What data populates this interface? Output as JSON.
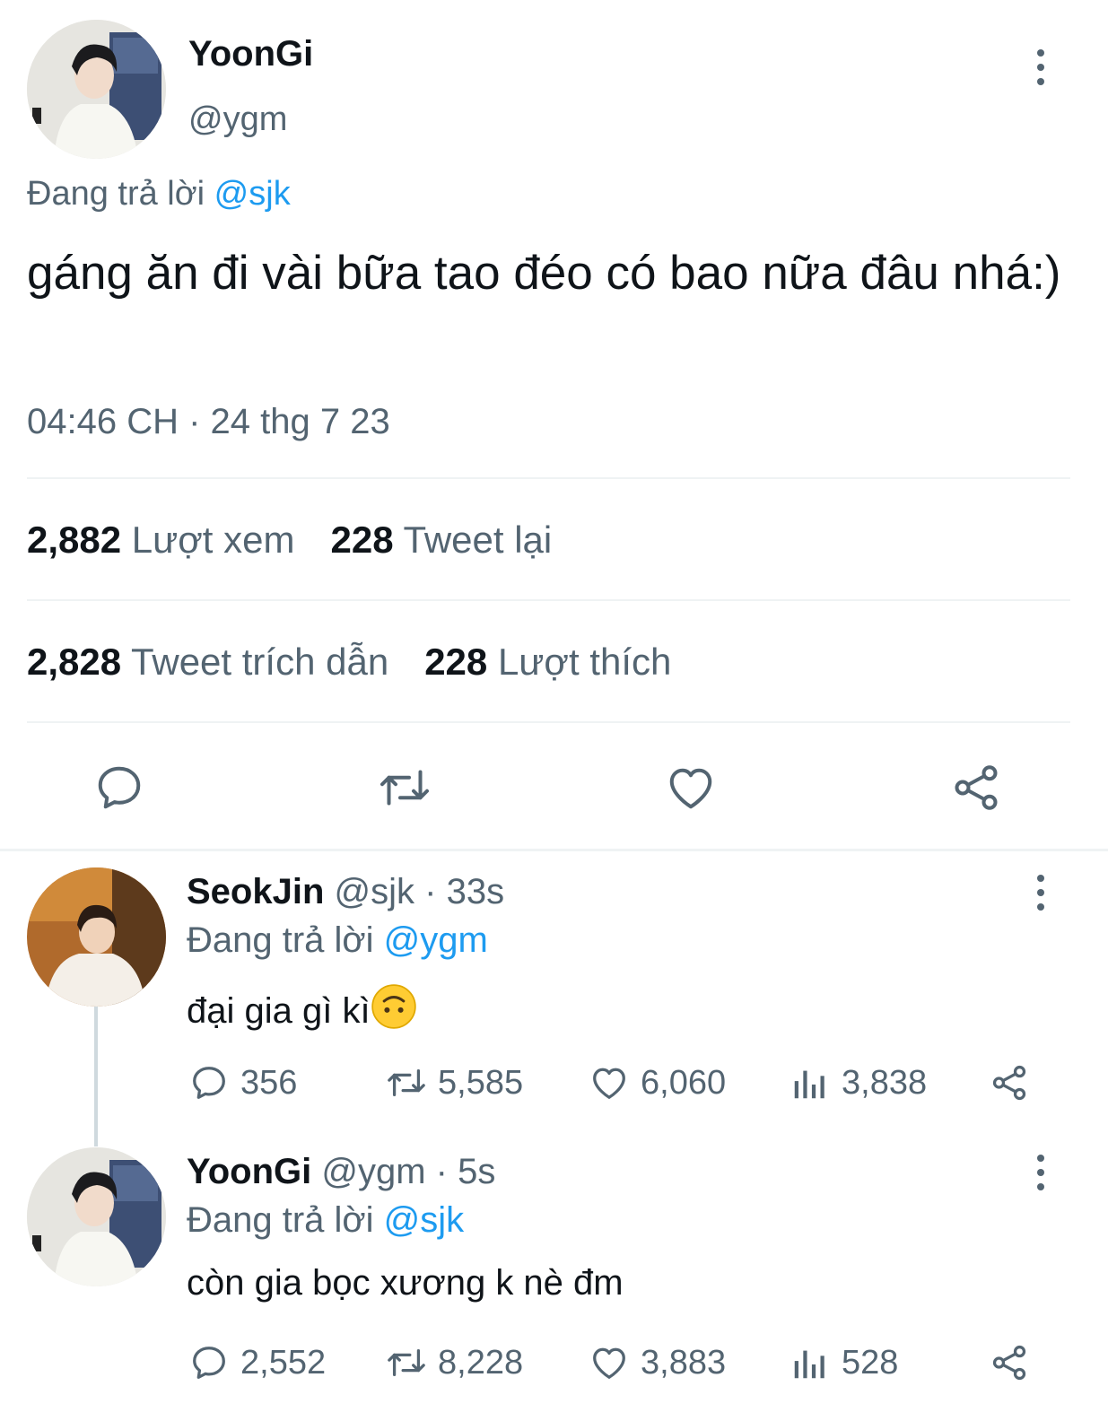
{
  "main_tweet": {
    "display_name": "YoonGi",
    "handle": "@ygm",
    "reply_prefix": "Đang trả lời",
    "reply_to": "@sjk",
    "text": "gáng ăn đi vài bữa tao đéo có bao nữa đâu nhá:)",
    "timestamp": "04:46 CH · 24 thg 7 23",
    "stats": {
      "views_num": "2,882",
      "views_label": "Lượt xem",
      "retweets_num": "228",
      "retweets_label": "Tweet lại",
      "quotes_num": "2,828",
      "quotes_label": "Tweet trích dẫn",
      "likes_num": "228",
      "likes_label": "Lượt thích"
    },
    "icons": [
      "reply-icon",
      "retweet-icon",
      "like-icon",
      "share-icon",
      "more-icon"
    ]
  },
  "replies": [
    {
      "display_name": "SeokJin",
      "handle": "@sjk",
      "time": "· 33s",
      "reply_prefix": "Đang trả lời",
      "reply_to": "@ygm",
      "text": "đại gia gì kì",
      "emoji": "upside-down-face-emoji",
      "counts": {
        "replies": "356",
        "retweets": "5,585",
        "likes": "6,060",
        "views": "3,838"
      }
    },
    {
      "display_name": "YoonGi",
      "handle": "@ygm",
      "time": "· 5s",
      "reply_prefix": "Đang trả lời",
      "reply_to": "@sjk",
      "text": "còn gia bọc xương k nè đm",
      "counts": {
        "replies": "2,552",
        "retweets": "8,228",
        "likes": "3,883",
        "views": "528"
      }
    }
  ],
  "colors": {
    "accent": "#1d9bf0",
    "secondary_text": "#536471",
    "primary_text": "#0f1419",
    "divider": "#eff3f4"
  }
}
